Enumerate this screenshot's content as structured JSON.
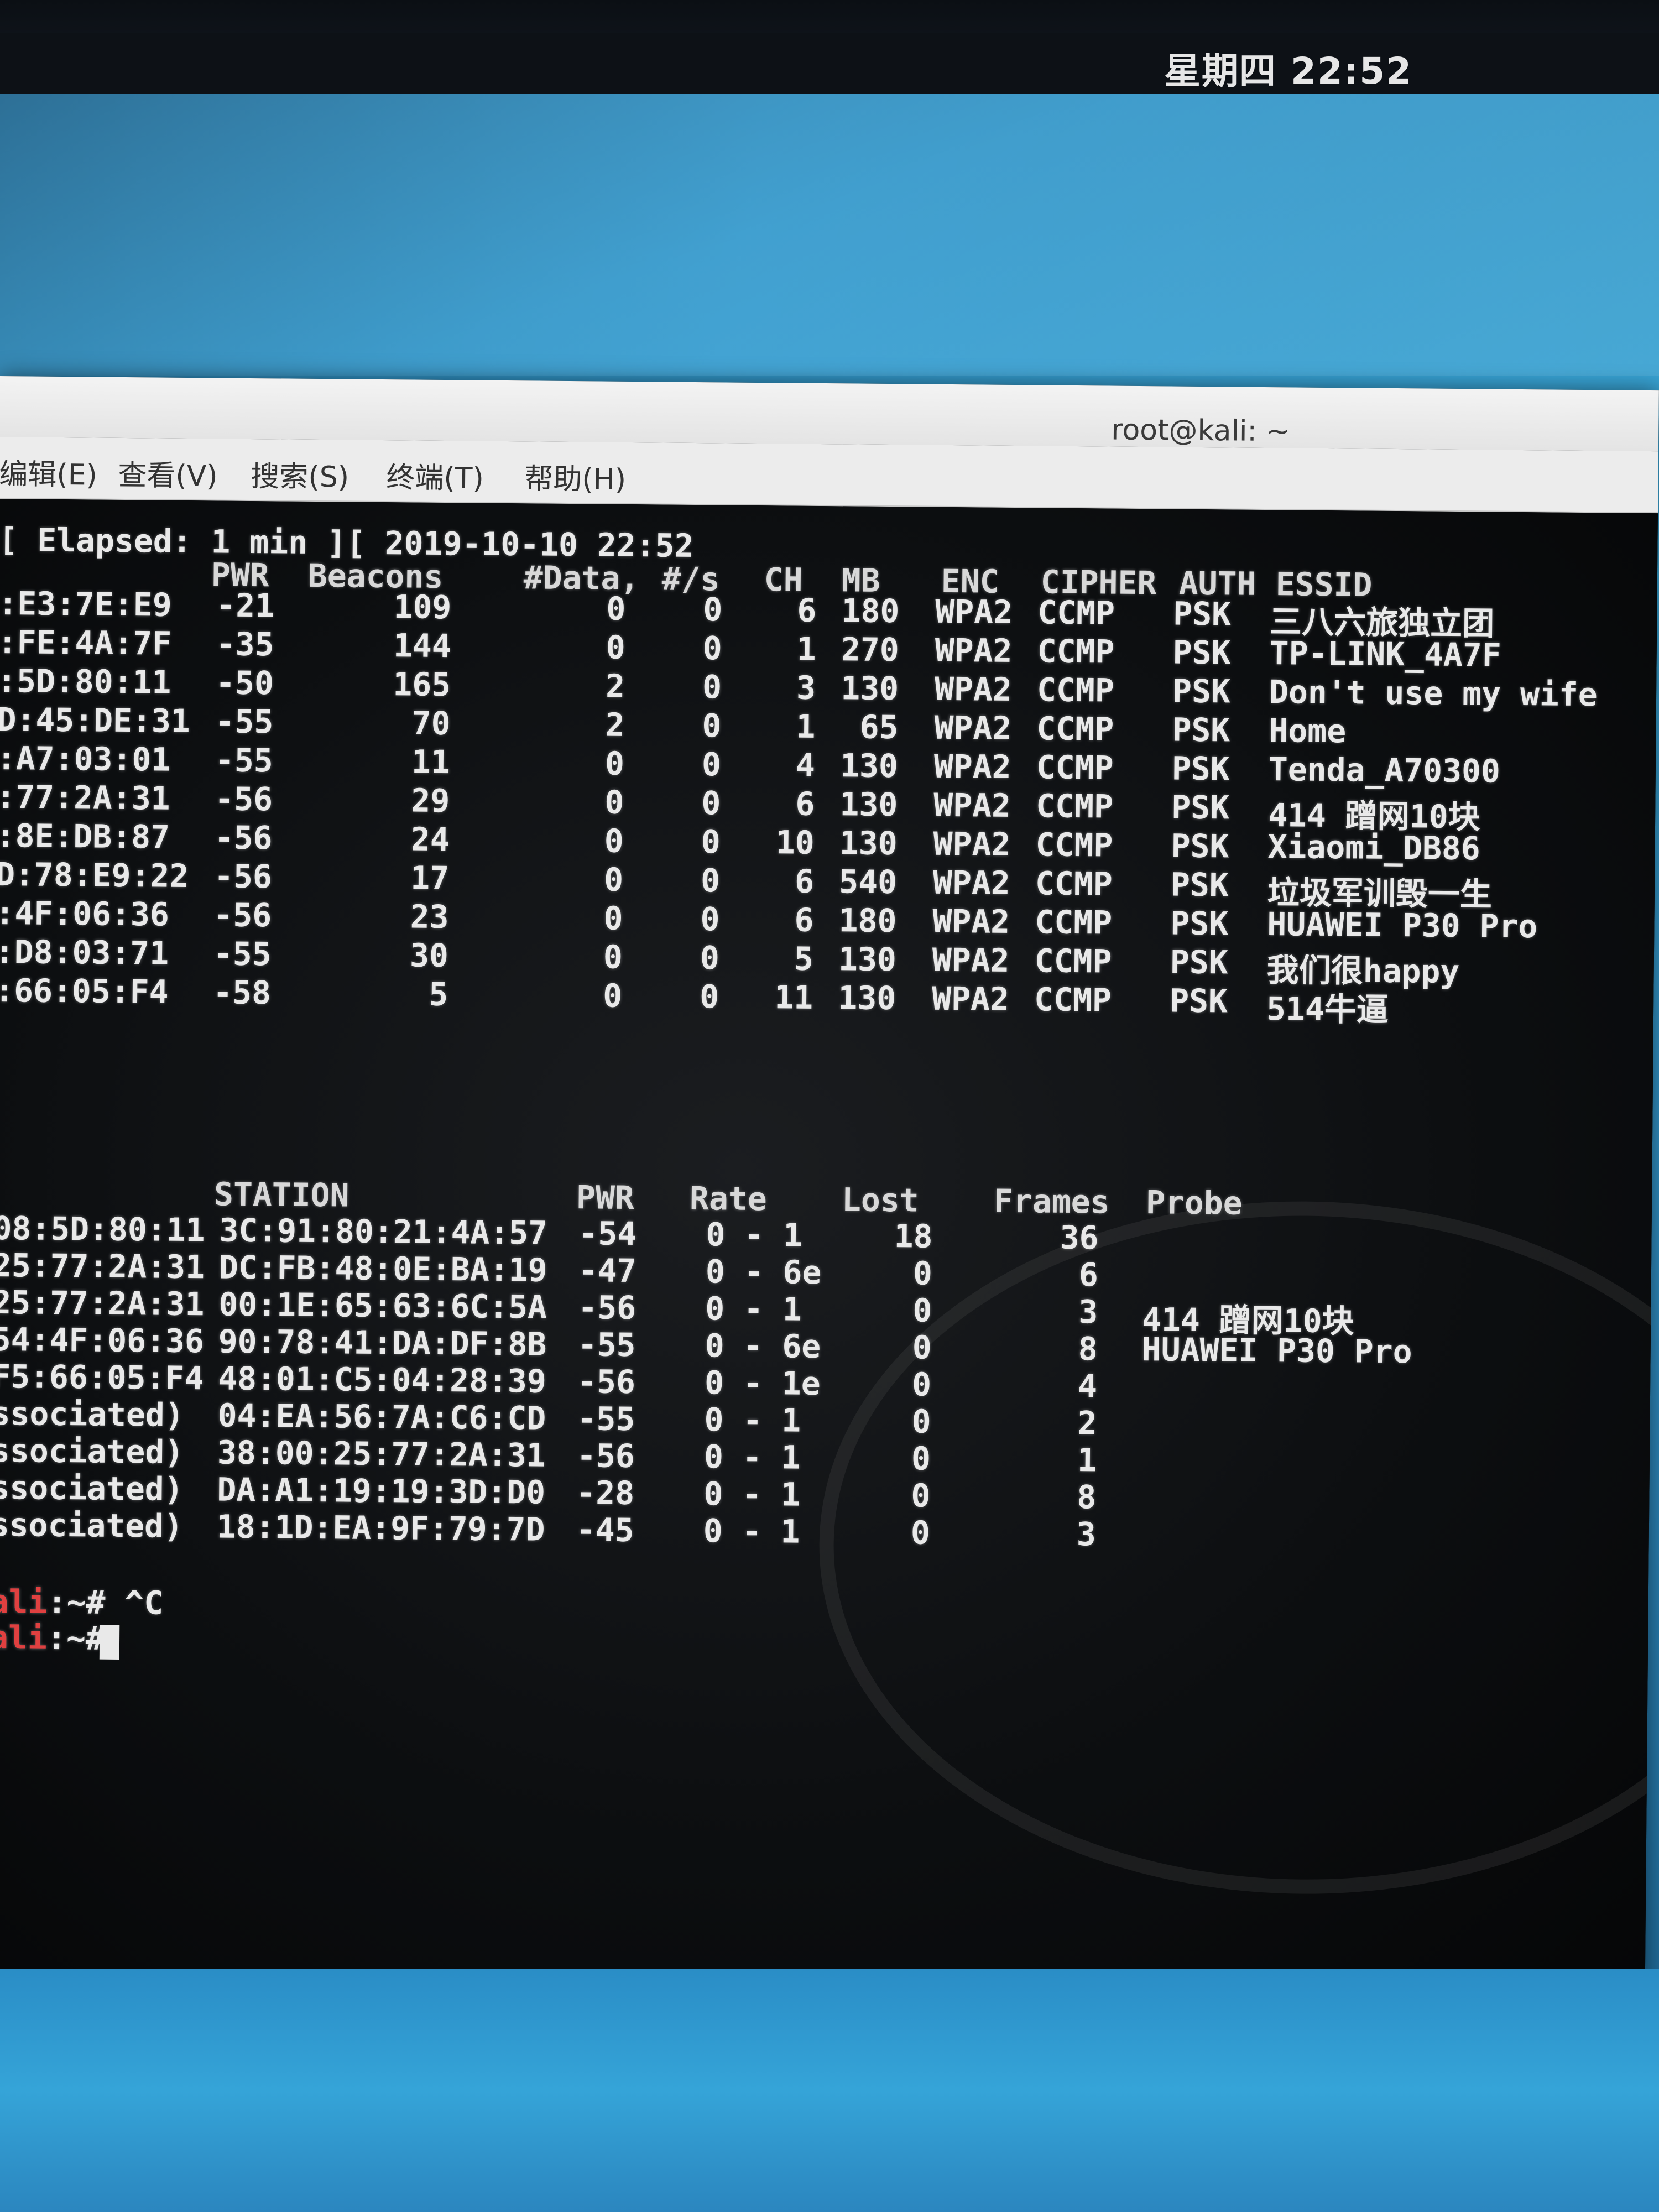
{
  "top_panel": {
    "clock": "星期四 22:52"
  },
  "window": {
    "title": "root@kali: ~",
    "menu": [
      "编辑(E)",
      "查看(V)",
      "搜索(S)",
      "终端(T)",
      "帮助(H)"
    ]
  },
  "terminal": {
    "status_line": "[ Elapsed: 1 min ][ 2019-10-10 22:52",
    "ap_headers": {
      "pwr": "PWR",
      "beacons": "Beacons",
      "data": "#Data,",
      "per_sec": "#/s",
      "ch": "CH",
      "mb": "MB",
      "enc": "ENC",
      "cipher": "CIPHER",
      "auth": "AUTH",
      "essid": "ESSID"
    },
    "access_points": [
      {
        "bssid": ":E3:7E:E9",
        "pwr": "-21",
        "beacons": "109",
        "data": "0",
        "per_sec": "0",
        "ch": "6",
        "mb": "180",
        "enc": "WPA2",
        "cipher": "CCMP",
        "auth": "PSK",
        "essid": "三八六旅独立团"
      },
      {
        "bssid": ":FE:4A:7F",
        "pwr": "-35",
        "beacons": "144",
        "data": "0",
        "per_sec": "0",
        "ch": "1",
        "mb": "270",
        "enc": "WPA2",
        "cipher": "CCMP",
        "auth": "PSK",
        "essid": "TP-LINK_4A7F"
      },
      {
        "bssid": ":5D:80:11",
        "pwr": "-50",
        "beacons": "165",
        "data": "2",
        "per_sec": "0",
        "ch": "3",
        "mb": "130",
        "enc": "WPA2",
        "cipher": "CCMP",
        "auth": "PSK",
        "essid": "Don't use my wife"
      },
      {
        "bssid": "D:45:DE:31",
        "pwr": "-55",
        "beacons": "70",
        "data": "2",
        "per_sec": "0",
        "ch": "1",
        "mb": "65",
        "enc": "WPA2",
        "cipher": "CCMP",
        "auth": "PSK",
        "essid": "Home"
      },
      {
        "bssid": ":A7:03:01",
        "pwr": "-55",
        "beacons": "11",
        "data": "0",
        "per_sec": "0",
        "ch": "4",
        "mb": "130",
        "enc": "WPA2",
        "cipher": "CCMP",
        "auth": "PSK",
        "essid": "Tenda_A70300"
      },
      {
        "bssid": ":77:2A:31",
        "pwr": "-56",
        "beacons": "29",
        "data": "0",
        "per_sec": "0",
        "ch": "6",
        "mb": "130",
        "enc": "WPA2",
        "cipher": "CCMP",
        "auth": "PSK",
        "essid": "414 蹭网10块"
      },
      {
        "bssid": ":8E:DB:87",
        "pwr": "-56",
        "beacons": "24",
        "data": "0",
        "per_sec": "0",
        "ch": "10",
        "mb": "130",
        "enc": "WPA2",
        "cipher": "CCMP",
        "auth": "PSK",
        "essid": "Xiaomi_DB86"
      },
      {
        "bssid": "D:78:E9:22",
        "pwr": "-56",
        "beacons": "17",
        "data": "0",
        "per_sec": "0",
        "ch": "6",
        "mb": "540",
        "enc": "WPA2",
        "cipher": "CCMP",
        "auth": "PSK",
        "essid": "垃圾军训毁一生"
      },
      {
        "bssid": ":4F:06:36",
        "pwr": "-56",
        "beacons": "23",
        "data": "0",
        "per_sec": "0",
        "ch": "6",
        "mb": "180",
        "enc": "WPA2",
        "cipher": "CCMP",
        "auth": "PSK",
        "essid": "HUAWEI P30 Pro"
      },
      {
        "bssid": ":D8:03:71",
        "pwr": "-55",
        "beacons": "30",
        "data": "0",
        "per_sec": "0",
        "ch": "5",
        "mb": "130",
        "enc": "WPA2",
        "cipher": "CCMP",
        "auth": "PSK",
        "essid": "我们很happy"
      },
      {
        "bssid": ":66:05:F4",
        "pwr": "-58",
        "beacons": "5",
        "data": "0",
        "per_sec": "0",
        "ch": "11",
        "mb": "130",
        "enc": "WPA2",
        "cipher": "CCMP",
        "auth": "PSK",
        "essid": "514牛逼"
      }
    ],
    "station_headers": {
      "station": "STATION",
      "pwr": "PWR",
      "rate": "Rate",
      "lost": "Lost",
      "frames": "Frames",
      "probe": "Probe"
    },
    "stations": [
      {
        "bssid": "08:5D:80:11",
        "station": "3C:91:80:21:4A:57",
        "pwr": "-54",
        "rate": "0 - 1",
        "lost": "18",
        "frames": "36",
        "probe": ""
      },
      {
        "bssid": "25:77:2A:31",
        "station": "DC:FB:48:0E:BA:19",
        "pwr": "-47",
        "rate": "0 - 6e",
        "lost": "0",
        "frames": "6",
        "probe": ""
      },
      {
        "bssid": "25:77:2A:31",
        "station": "00:1E:65:63:6C:5A",
        "pwr": "-56",
        "rate": "0 - 1",
        "lost": "0",
        "frames": "3",
        "probe": "414 蹭网10块"
      },
      {
        "bssid": "54:4F:06:36",
        "station": "90:78:41:DA:DF:8B",
        "pwr": "-55",
        "rate": "0 - 6e",
        "lost": "0",
        "frames": "8",
        "probe": "HUAWEI P30 Pro"
      },
      {
        "bssid": "F5:66:05:F4",
        "station": "48:01:C5:04:28:39",
        "pwr": "-56",
        "rate": "0 - 1e",
        "lost": "0",
        "frames": "4",
        "probe": ""
      },
      {
        "bssid": "ssociated)",
        "station": "04:EA:56:7A:C6:CD",
        "pwr": "-55",
        "rate": "0 - 1",
        "lost": "0",
        "frames": "2",
        "probe": ""
      },
      {
        "bssid": "ssociated)",
        "station": "38:00:25:77:2A:31",
        "pwr": "-56",
        "rate": "0 - 1",
        "lost": "0",
        "frames": "1",
        "probe": ""
      },
      {
        "bssid": "ssociated)",
        "station": "DA:A1:19:19:3D:D0",
        "pwr": "-28",
        "rate": "0 - 1",
        "lost": "0",
        "frames": "8",
        "probe": ""
      },
      {
        "bssid": "ssociated)",
        "station": "18:1D:EA:9F:79:7D",
        "pwr": "-45",
        "rate": "0 - 1",
        "lost": "0",
        "frames": "3",
        "probe": ""
      }
    ],
    "prompt_lines": [
      {
        "host": "ali",
        "rest": ":~# ^C"
      },
      {
        "host": "ali",
        "rest": ":~# "
      }
    ]
  }
}
